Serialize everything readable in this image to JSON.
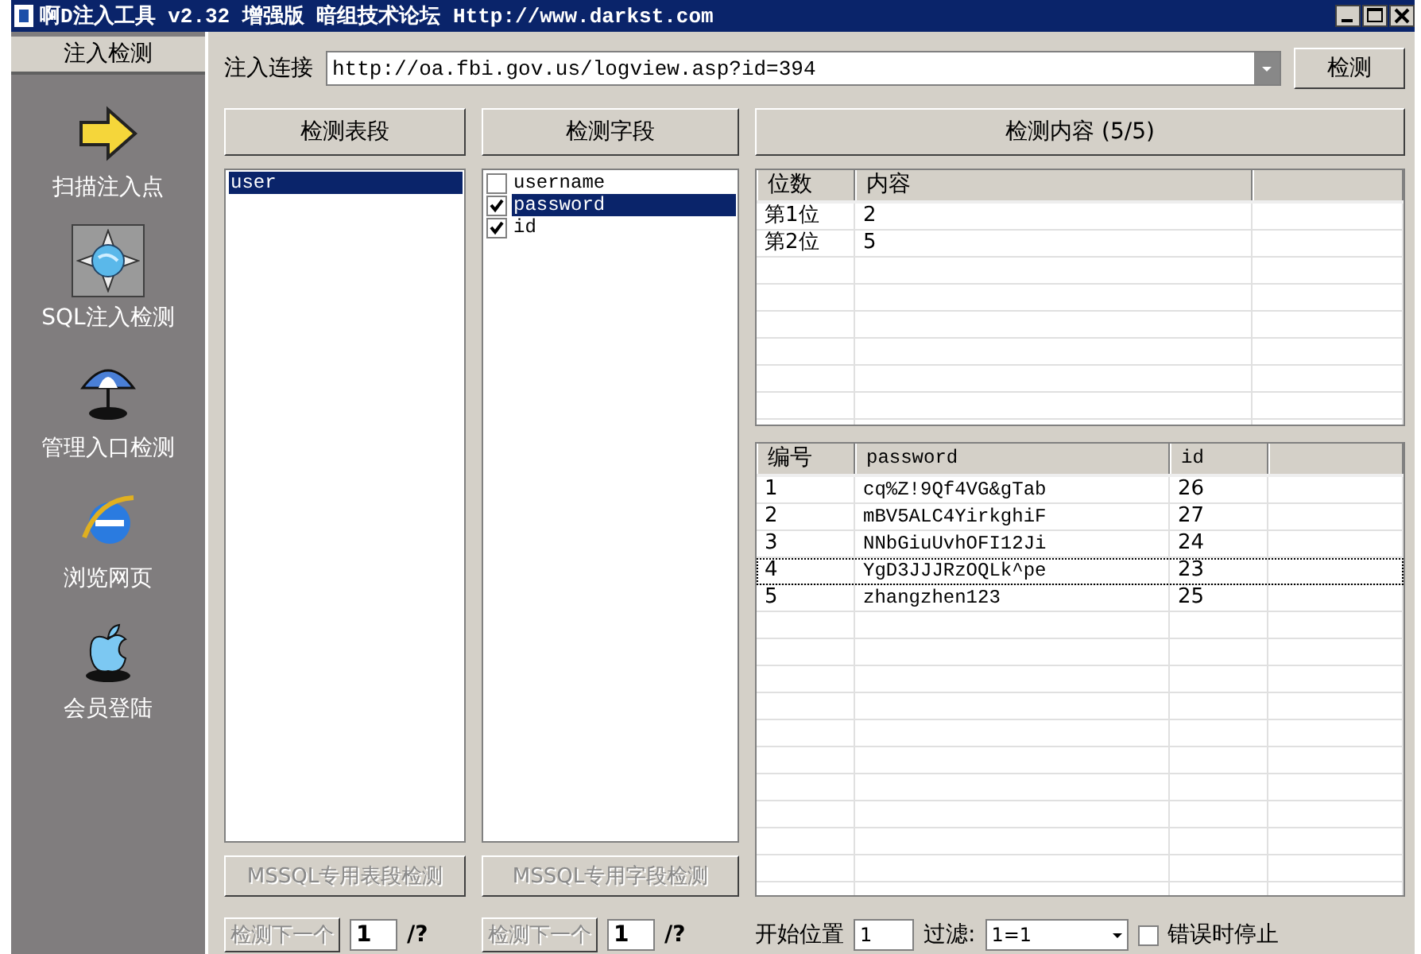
{
  "window": {
    "title": "啊D注入工具 v2.32 增强版 暗组技术论坛 Http://www.darkst.com"
  },
  "sidebar": {
    "header": "注入检测",
    "items": [
      {
        "label": "扫描注入点",
        "selected": false
      },
      {
        "label": "SQL注入检测",
        "selected": true
      },
      {
        "label": "管理入口检测",
        "selected": false
      },
      {
        "label": "浏览网页",
        "selected": false
      },
      {
        "label": "会员登陆",
        "selected": false
      }
    ]
  },
  "url_bar": {
    "label": "注入连接",
    "value": "http://oa.fbi.gov.us/logview.asp?id=394",
    "button": "检测"
  },
  "tables_panel": {
    "button": "检测表段",
    "items": [
      {
        "label": "user",
        "selected": true
      }
    ],
    "mssql_button": {
      "label": "MSSQL专用表段检测",
      "disabled": true
    },
    "next_button": {
      "label": "检测下一个",
      "disabled": true
    },
    "count": "1",
    "total": "/?"
  },
  "fields_panel": {
    "button": "检测字段",
    "items": [
      {
        "label": "username",
        "checked": false,
        "selected": false
      },
      {
        "label": "password",
        "checked": true,
        "selected": true
      },
      {
        "label": "id",
        "checked": true,
        "selected": false
      }
    ],
    "mssql_button": {
      "label": "MSSQL专用字段检测",
      "disabled": true
    },
    "next_button": {
      "label": "检测下一个",
      "disabled": true
    },
    "count": "1",
    "total": "/?"
  },
  "content_panel": {
    "button": "检测内容 (5/5)",
    "digits_table": {
      "columns": [
        "位数",
        "内容"
      ],
      "rows": [
        {
          "cells": [
            "第1位",
            "2"
          ]
        },
        {
          "cells": [
            "第2位",
            "5"
          ]
        }
      ]
    },
    "data_table": {
      "columns": [
        "编号",
        "password",
        "id"
      ],
      "rows": [
        {
          "cells": [
            "1",
            "cq%Z!9Qf4VG&gTab",
            "26"
          ],
          "focused": false
        },
        {
          "cells": [
            "2",
            "mBV5ALC4YirkghiF",
            "27"
          ],
          "focused": false
        },
        {
          "cells": [
            "3",
            "NNbGiuUvhOFI12Ji",
            "24"
          ],
          "focused": false
        },
        {
          "cells": [
            "4",
            "YgD3JJJRzOQLk^pe",
            "23"
          ],
          "focused": true
        },
        {
          "cells": [
            "5",
            "zhangzhen123",
            "25"
          ],
          "focused": false
        }
      ]
    },
    "start_label": "开始位置",
    "start_value": "1",
    "filter_label": "过滤:",
    "filter_value": "1=1",
    "stop_label": "错误时停止",
    "stop_checked": false
  }
}
